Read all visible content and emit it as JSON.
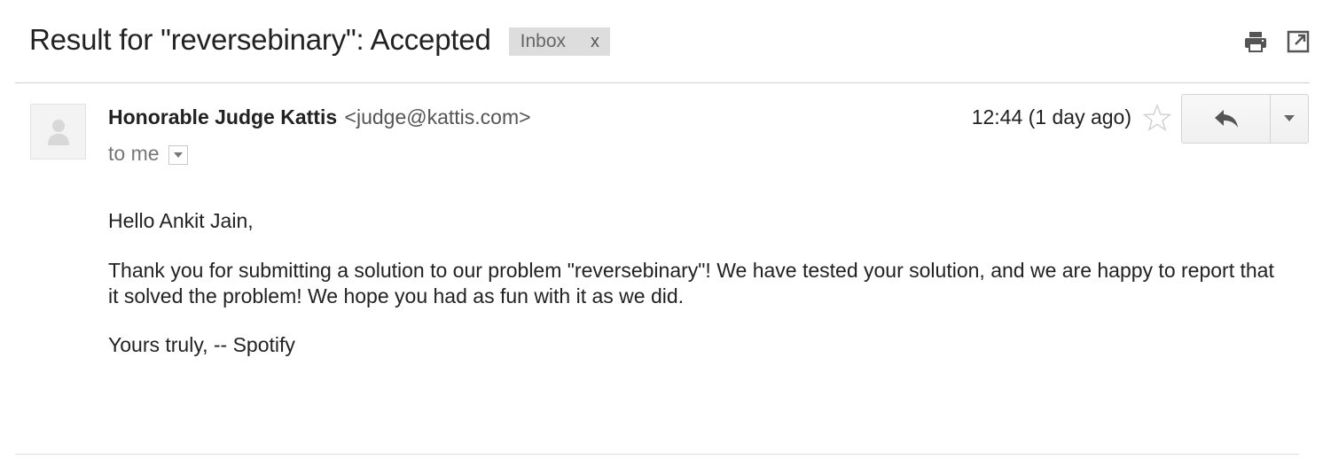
{
  "subject": "Result for \"reversebinary\": Accepted",
  "label": {
    "name": "Inbox",
    "remove": "x"
  },
  "toolbar_icons": [
    "print-icon",
    "new-window-icon"
  ],
  "sender": {
    "name": "Honorable Judge Kattis",
    "email": "<judge@kattis.com>",
    "recipients": "to me"
  },
  "timestamp": "12:44 (1 day ago)",
  "actions": {
    "reply_icon": "reply-icon",
    "more_icon": "chevron-down-icon",
    "star_icon": "star-outline-icon"
  },
  "body": {
    "greeting": "Hello Ankit Jain,",
    "paragraph": "Thank you for submitting a solution to our problem \"reversebinary\"! We have tested your solution, and we are happy to report that it solved the problem! We hope you had as fun with it as we did.",
    "signoff": "Yours truly, -- Spotify"
  },
  "colors": {
    "label_bg": "#dddddd",
    "divider": "#cfcfcf",
    "text": "#222222",
    "muted": "#777777"
  }
}
